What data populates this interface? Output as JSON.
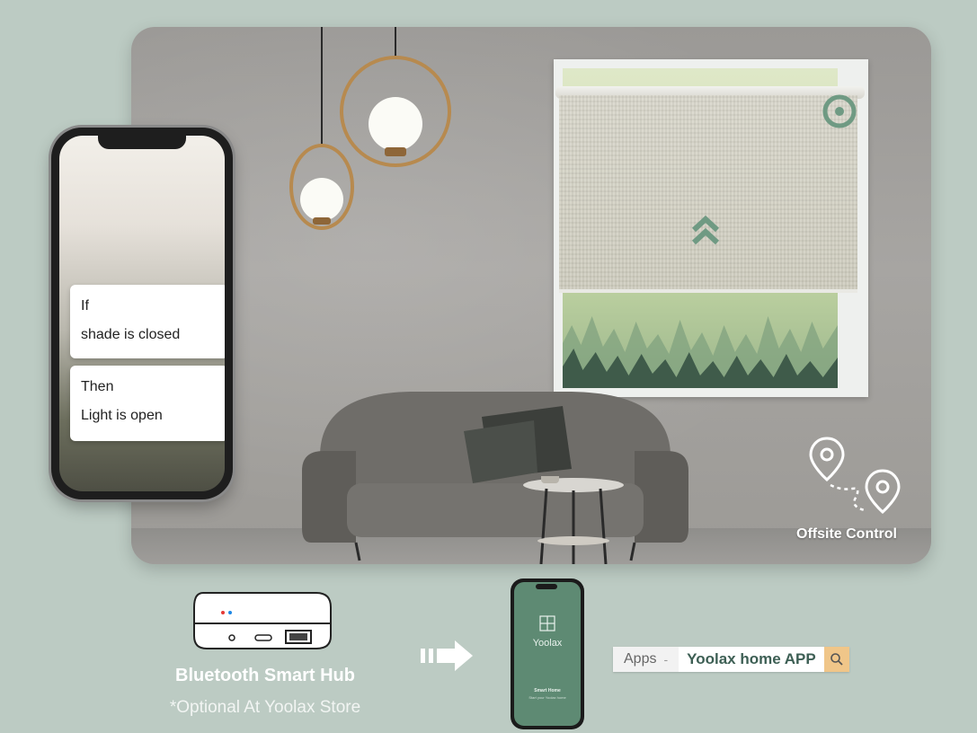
{
  "scene": {
    "offsite_label": "Offsite Control"
  },
  "phone_automation": {
    "if_title": "If",
    "if_condition": "shade is closed",
    "then_title": "Then",
    "then_action": "Light is open"
  },
  "hub": {
    "title": "Bluetooth Smart Hub",
    "subtitle": "*Optional At Yoolax Store"
  },
  "app_phone": {
    "brand": "Yoolax",
    "tagline": "Smart Home",
    "tagline_sub": "Start your Yoolax home"
  },
  "search": {
    "apps_label": "Apps",
    "separator": "-",
    "query": "Yoolax home APP",
    "search_icon": "search-icon"
  },
  "colors": {
    "background": "#bccbc3",
    "accent_green": "#5e8a73",
    "search_button": "#f0c689"
  }
}
